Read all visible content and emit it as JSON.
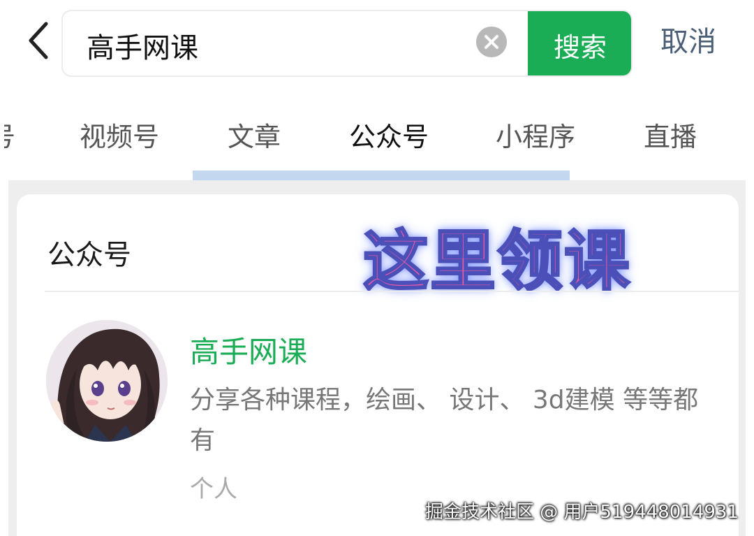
{
  "search": {
    "query": "高手网课",
    "button_label": "搜索",
    "cancel_label": "取消"
  },
  "tabs": [
    {
      "label": "视频号",
      "active": false
    },
    {
      "label": "文章",
      "active": false
    },
    {
      "label": "公众号",
      "active": true
    },
    {
      "label": "小程序",
      "active": false
    },
    {
      "label": "直播",
      "active": false
    }
  ],
  "tab_partial_label": "号",
  "section": {
    "title": "公众号",
    "overlay_text": "这里领课"
  },
  "result": {
    "name": "高手网课",
    "description": "分享各种课程，绘画、 设计、 3d建模 等等都有",
    "type": "个人",
    "avatar": "anime-girl-avatar"
  },
  "watermark": "掘金技术社区 @ 用户519448014931",
  "colors": {
    "accent_green": "#1aad55",
    "link_blue": "#4b5e78",
    "overlay_pink": "#f05aa6",
    "tab_underline": "#c3d8ee"
  }
}
